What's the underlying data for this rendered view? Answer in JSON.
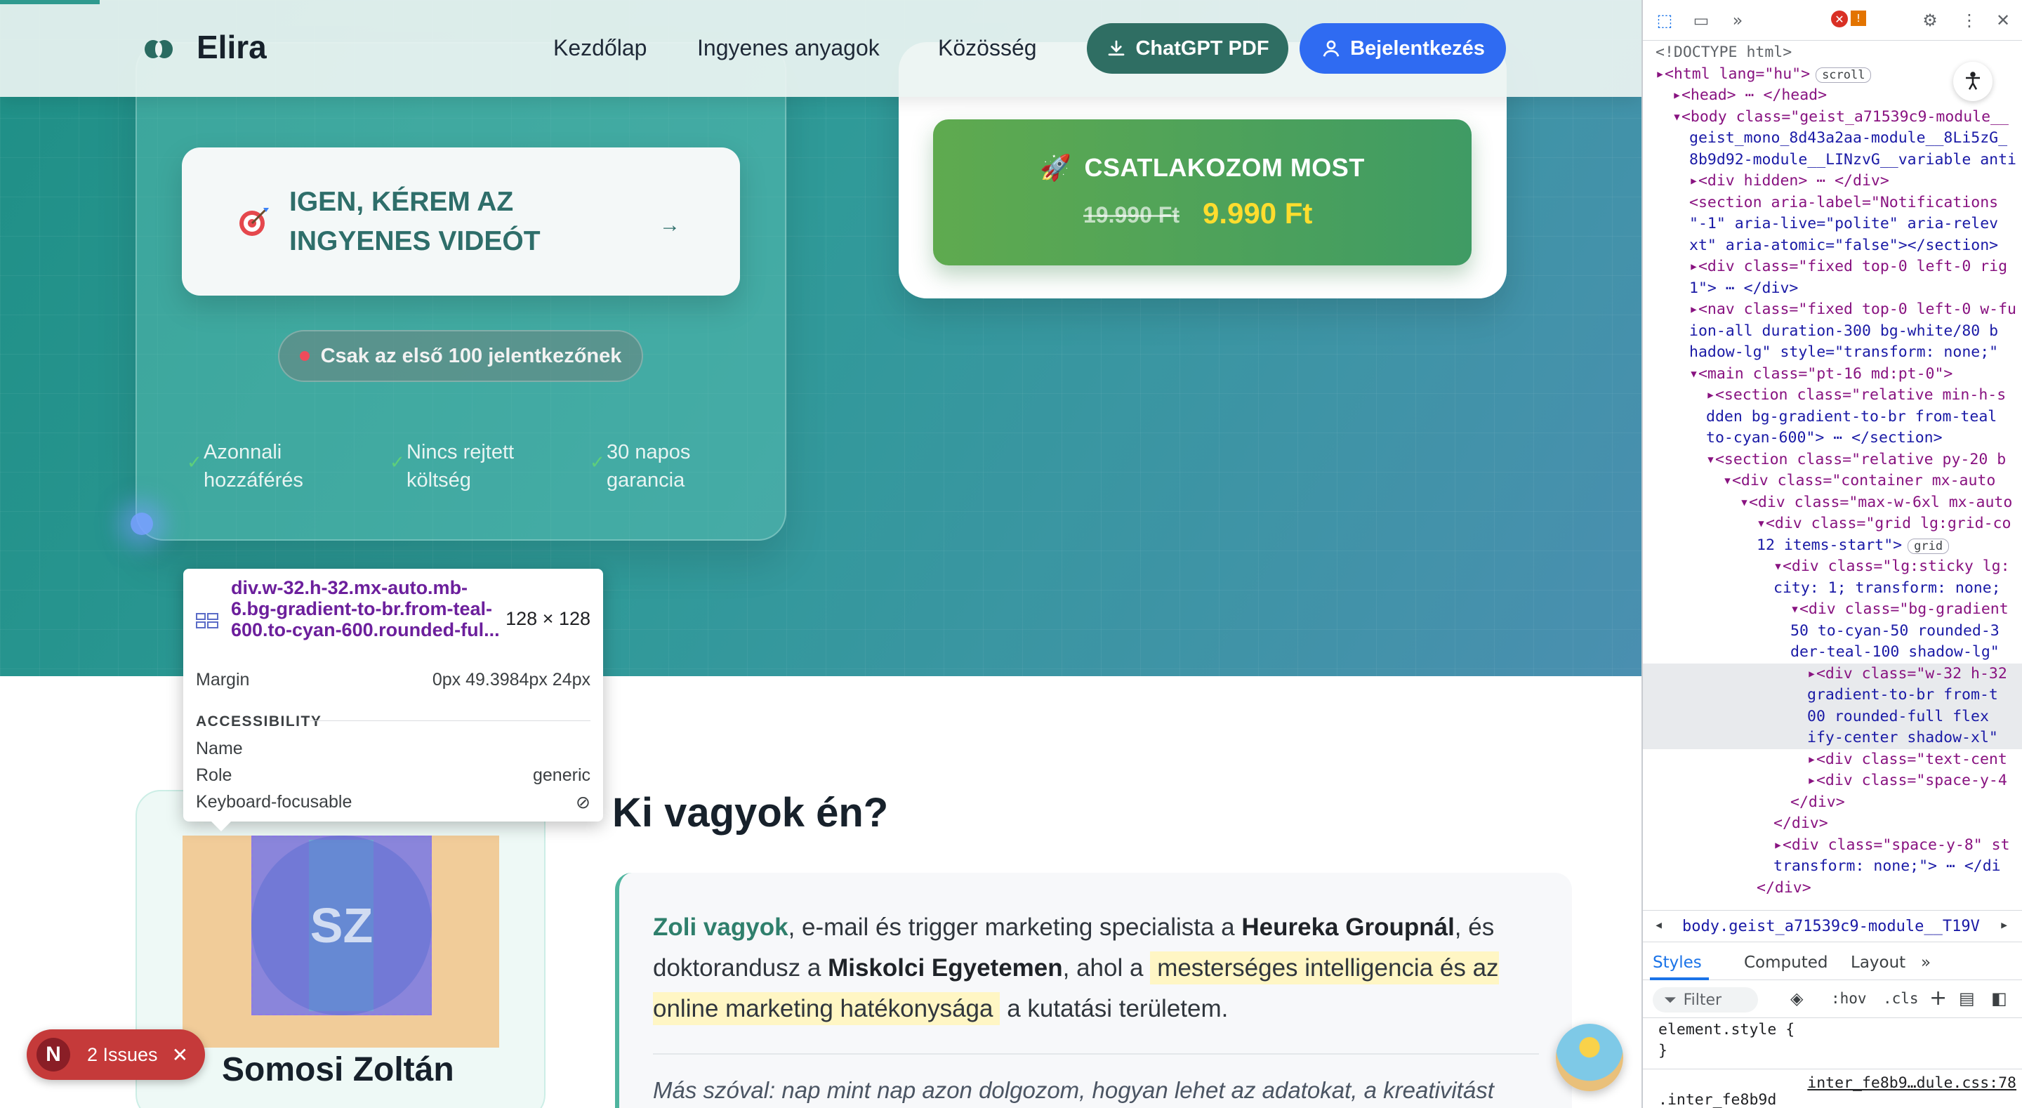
{
  "nav": {
    "brand": "Elira",
    "links": [
      "Kezdőlap",
      "Ingyenes anyagok",
      "Közösség"
    ],
    "pdf_button": "ChatGPT PDF",
    "login_button": "Bejelentkezés"
  },
  "hero": {
    "free_video_cta": "IGEN, KÉREM AZ INGYENES VIDEÓT",
    "first100_badge": "Csak az első 100 jelentkezőnek",
    "features": [
      "Azonnali hozzáférés",
      "Nincs rejtett költség",
      "30 napos garancia"
    ],
    "join_cta": "CSATLAKOZOM MOST",
    "old_price": "19.990 Ft",
    "new_price": "9.990 Ft"
  },
  "about": {
    "title": "Ki vagyok én?",
    "avatar_initials": "SZ",
    "profile_name": "Somosi Zoltán",
    "bio": {
      "name": "Zoli vagyok",
      "part1": ", e-mail és trigger marketing specialista a ",
      "company": "Heureka Groupnál",
      "part2": ", és doktorandusz a ",
      "university": "Miskolci Egyetemen",
      "part3": ", ahol a ",
      "highlight": "mesterséges intelligencia és az online marketing hatékonysága",
      "part4": " a kutatási területem."
    },
    "quote": "Más szóval: nap mint nap azon dolgozom, hogyan lehet az adatokat, a kreativitást"
  },
  "inspect_tooltip": {
    "selector": "div.w-32.h-32.mx-auto.mb-6.bg-gradient-to-br.from-teal-600.to-cyan-600.rounded-ful...",
    "size": "128 × 128",
    "margin_label": "Margin",
    "margin_value": "0px 49.3984px 24px",
    "accessibility_heading": "ACCESSIBILITY",
    "name_label": "Name",
    "role_label": "Role",
    "role_value": "generic",
    "focusable_label": "Keyboard-focusable"
  },
  "issues": {
    "initial": "N",
    "label": "2 Issues"
  },
  "devtools": {
    "breadcrumb": "body.geist_a71539c9-module__T19V",
    "tabs": [
      "Styles",
      "Computed",
      "Layout"
    ],
    "filter_placeholder": "Filter",
    "hov": ":hov",
    "cls": ".cls",
    "style_rule1": "element.style {",
    "style_rule1_close": "}",
    "style_source": "inter_fe8b9…dule.css:78",
    "style_rule2": ".inter_fe8b9d",
    "tree": [
      {
        "indent": 0,
        "text": "<!DOCTYPE html>",
        "kind": "comment"
      },
      {
        "indent": 0,
        "text": "▸<html lang=\"hu\">",
        "pill": "scroll"
      },
      {
        "indent": 1,
        "text": "▸<head> ⋯ </head>"
      },
      {
        "indent": 1,
        "text": "▾<body class=\"geist_a71539c9-module__"
      },
      {
        "indent": 2,
        "text": "geist_mono_8d43a2aa-module__8Li5zG_",
        "kind": "val"
      },
      {
        "indent": 2,
        "text": "8b9d92-module__LINzvG__variable anti",
        "kind": "val"
      },
      {
        "indent": 2,
        "text": "▸<div hidden> ⋯ </div>"
      },
      {
        "indent": 2,
        "text": "<section aria-label=\"Notifications"
      },
      {
        "indent": 2,
        "text": "\"-1\" aria-live=\"polite\" aria-relev",
        "kind": "val"
      },
      {
        "indent": 2,
        "text": "xt\" aria-atomic=\"false\"></section>",
        "kind": "val"
      },
      {
        "indent": 2,
        "text": "▸<div class=\"fixed top-0 left-0 rig"
      },
      {
        "indent": 2,
        "text": "1\"> ⋯ </div>",
        "kind": "val"
      },
      {
        "indent": 2,
        "text": "▸<nav class=\"fixed top-0 left-0 w-fu"
      },
      {
        "indent": 2,
        "text": "ion-all duration-300 bg-white/80 b",
        "kind": "val"
      },
      {
        "indent": 2,
        "text": "hadow-lg\" style=\"transform: none;\"",
        "kind": "val"
      },
      {
        "indent": 2,
        "text": "▾<main class=\"pt-16 md:pt-0\">"
      },
      {
        "indent": 3,
        "text": "▸<section class=\"relative min-h-s"
      },
      {
        "indent": 3,
        "text": "dden bg-gradient-to-br from-teal",
        "kind": "val"
      },
      {
        "indent": 3,
        "text": "to-cyan-600\"> ⋯ </section>",
        "kind": "val"
      },
      {
        "indent": 3,
        "text": "▾<section class=\"relative py-20 b"
      },
      {
        "indent": 4,
        "text": "▾<div class=\"container mx-auto"
      },
      {
        "indent": 5,
        "text": "▾<div class=\"max-w-6xl mx-auto"
      },
      {
        "indent": 6,
        "text": "▾<div class=\"grid lg:grid-co"
      },
      {
        "indent": 6,
        "text": "12 items-start\">",
        "kind": "val",
        "pill": "grid"
      },
      {
        "indent": 7,
        "text": "▾<div class=\"lg:sticky lg:"
      },
      {
        "indent": 7,
        "text": "city: 1; transform: none;",
        "kind": "val"
      },
      {
        "indent": 8,
        "text": "▾<div class=\"bg-gradient"
      },
      {
        "indent": 8,
        "text": "50 to-cyan-50 rounded-3",
        "kind": "val"
      },
      {
        "indent": 8,
        "text": "der-teal-100 shadow-lg\"",
        "kind": "val"
      },
      {
        "indent": 9,
        "text": "▸<div class=\"w-32 h-32",
        "sel": true
      },
      {
        "indent": 9,
        "text": "gradient-to-br from-t",
        "kind": "val",
        "sel": true
      },
      {
        "indent": 9,
        "text": "00 rounded-full flex",
        "kind": "val",
        "sel": true
      },
      {
        "indent": 9,
        "text": "ify-center shadow-xl\"",
        "kind": "val",
        "sel": true
      },
      {
        "indent": 9,
        "text": "▸<div class=\"text-cent"
      },
      {
        "indent": 9,
        "text": "▸<div class=\"space-y-4"
      },
      {
        "indent": 8,
        "text": "</div>"
      },
      {
        "indent": 7,
        "text": "</div>"
      },
      {
        "indent": 7,
        "text": "▸<div class=\"space-y-8\" st"
      },
      {
        "indent": 7,
        "text": "transform: none;\"> ⋯ </di",
        "kind": "val"
      },
      {
        "indent": 6,
        "text": "</div>"
      }
    ]
  }
}
